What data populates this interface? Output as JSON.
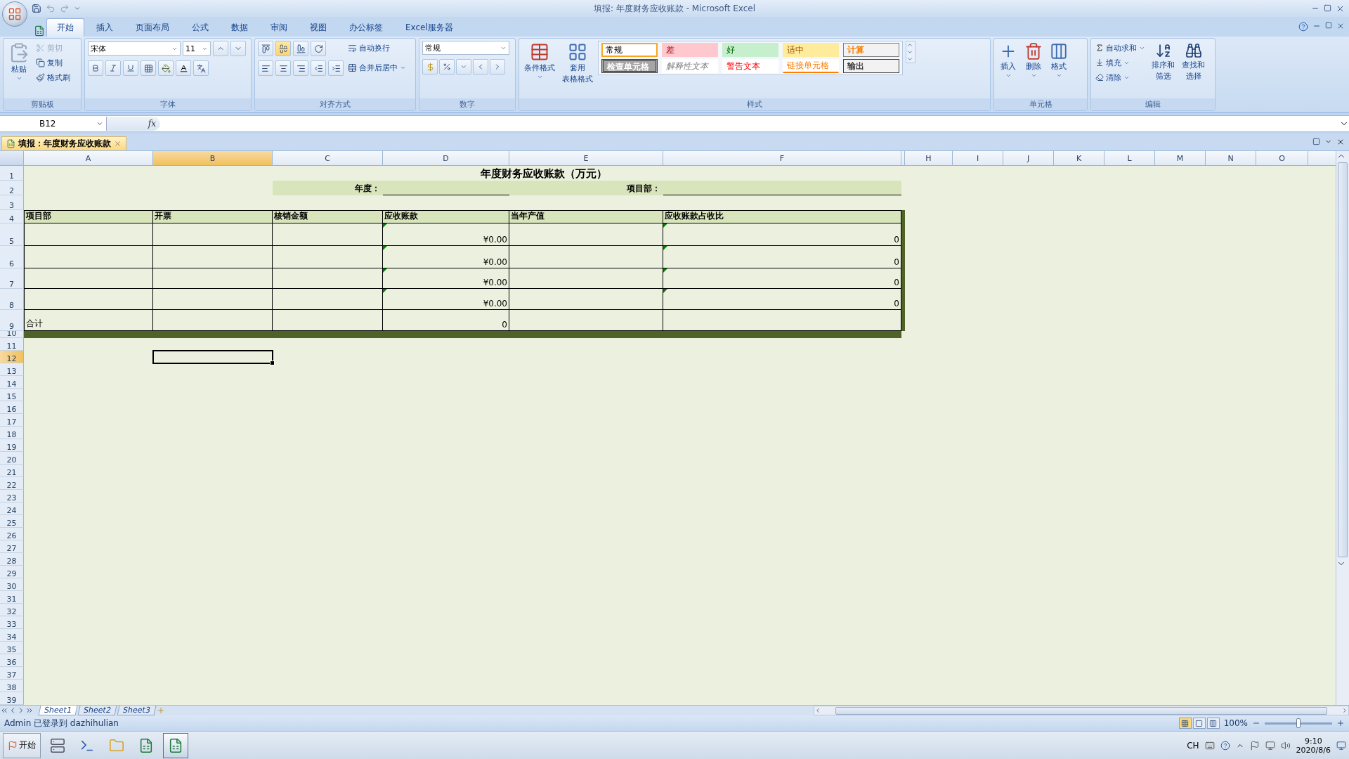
{
  "title_bar": {
    "title": "填报: 年度财务应收账款 - Microsoft Excel"
  },
  "ribbon_tabs": [
    {
      "label": "开始",
      "selected": true
    },
    {
      "label": "插入",
      "selected": false
    },
    {
      "label": "页面布局",
      "selected": false
    },
    {
      "label": "公式",
      "selected": false
    },
    {
      "label": "数据",
      "selected": false
    },
    {
      "label": "审阅",
      "selected": false
    },
    {
      "label": "视图",
      "selected": false
    },
    {
      "label": "办公标签",
      "selected": false
    },
    {
      "label": "Excel服务器",
      "selected": false
    }
  ],
  "ribbon": {
    "clipboard": {
      "title": "剪贴板",
      "paste": "粘贴",
      "cut": {
        "label": "剪切",
        "disabled": true
      },
      "copy": {
        "label": "复制",
        "disabled": false
      },
      "format_painter": {
        "label": "格式刷",
        "disabled": false
      }
    },
    "font": {
      "title": "字体",
      "font_name": "宋体",
      "font_size": "11"
    },
    "alignment": {
      "title": "对齐方式",
      "vertical": [
        {
          "selected": false
        },
        {
          "selected": true
        },
        {
          "selected": false
        }
      ],
      "wrap_text": "自动换行",
      "merge_center": "合并后居中"
    },
    "number": {
      "title": "数字",
      "format": "常规"
    },
    "styles": {
      "title": "样式",
      "conditional": [
        "条件格式"
      ],
      "table_format": [
        "套用",
        "表格格式"
      ],
      "cell_styles": [
        {
          "label": "常规",
          "kind": "normal",
          "selected": true
        },
        {
          "label": "差",
          "kind": "bad",
          "selected": false
        },
        {
          "label": "好",
          "kind": "good",
          "selected": false
        },
        {
          "label": "适中",
          "kind": "neutral",
          "selected": false
        },
        {
          "label": "计算",
          "kind": "calculation",
          "selected": false
        },
        {
          "label": "检查单元格",
          "kind": "check",
          "selected": false
        },
        {
          "label": "解释性文本",
          "kind": "explanatory",
          "selected": false
        },
        {
          "label": "警告文本",
          "kind": "warning",
          "selected": false
        },
        {
          "label": "链接单元格",
          "kind": "linked",
          "selected": false
        },
        {
          "label": "输出",
          "kind": "output",
          "selected": false
        }
      ]
    },
    "cells": {
      "title": "单元格",
      "insert": "插入",
      "delete": "删除",
      "format": "格式"
    },
    "editing": {
      "title": "编辑",
      "autosum": "自动求和",
      "fill": "填充",
      "clear": "清除",
      "sort": [
        "排序和",
        "筛选"
      ],
      "find": [
        "查找和",
        "选择"
      ]
    }
  },
  "formula_bar": {
    "name_box": "B12",
    "function_label": "fx"
  },
  "workbook_tab": {
    "title": "填报：年度财务应收账款"
  },
  "sheet": {
    "column_headers": [
      {
        "label": "A",
        "selected": false
      },
      {
        "label": "B",
        "selected": true
      },
      {
        "label": "C",
        "selected": false
      },
      {
        "label": "D",
        "selected": false
      },
      {
        "label": "E",
        "selected": false
      },
      {
        "label": "F",
        "selected": false
      },
      {
        "label": "H",
        "selected": false
      },
      {
        "label": "I",
        "selected": false
      },
      {
        "label": "J",
        "selected": false
      },
      {
        "label": "K",
        "selected": false
      },
      {
        "label": "L",
        "selected": false
      },
      {
        "label": "M",
        "selected": false
      },
      {
        "label": "N",
        "selected": false
      },
      {
        "label": "O",
        "selected": false
      }
    ],
    "row_headers": [
      {
        "label": "1",
        "selected": false
      },
      {
        "label": "2",
        "selected": false
      },
      {
        "label": "3",
        "selected": false
      },
      {
        "label": "4",
        "selected": false
      },
      {
        "label": "5",
        "selected": false
      },
      {
        "label": "6",
        "selected": false
      },
      {
        "label": "7",
        "selected": false
      },
      {
        "label": "8",
        "selected": false
      },
      {
        "label": "9",
        "selected": false
      },
      {
        "label": "10",
        "selected": false
      },
      {
        "label": "11",
        "selected": false
      },
      {
        "label": "12",
        "selected": true
      },
      {
        "label": "13",
        "selected": false
      },
      {
        "label": "14",
        "selected": false
      },
      {
        "label": "15",
        "selected": false
      },
      {
        "label": "16",
        "selected": false
      },
      {
        "label": "17",
        "selected": false
      },
      {
        "label": "18",
        "selected": false
      },
      {
        "label": "19",
        "selected": false
      },
      {
        "label": "20",
        "selected": false
      },
      {
        "label": "21",
        "selected": false
      },
      {
        "label": "22",
        "selected": false
      },
      {
        "label": "23",
        "selected": false
      },
      {
        "label": "24",
        "selected": false
      },
      {
        "label": "25",
        "selected": false
      },
      {
        "label": "26",
        "selected": false
      },
      {
        "label": "27",
        "selected": false
      },
      {
        "label": "28",
        "selected": false
      },
      {
        "label": "29",
        "selected": false
      },
      {
        "label": "30",
        "selected": false
      },
      {
        "label": "31",
        "selected": false
      },
      {
        "label": "32",
        "selected": false
      },
      {
        "label": "33",
        "selected": false
      },
      {
        "label": "34",
        "selected": false
      },
      {
        "label": "35",
        "selected": false
      },
      {
        "label": "36",
        "selected": false
      },
      {
        "label": "37",
        "selected": false
      },
      {
        "label": "38",
        "selected": false
      },
      {
        "label": "39",
        "selected": false
      }
    ],
    "report": {
      "title": "年度财务应收账款（万元）",
      "year_label": "年度：",
      "dept_label": "项目部：",
      "columns": [
        "项目部",
        "开票",
        "核销金额",
        "应收账款",
        "当年产值",
        "应收账款占收比"
      ],
      "rows": [
        {
          "receivable": "¥0.00",
          "receivable_flagged": true,
          "ratio": "0",
          "ratio_flagged": true
        },
        {
          "receivable": "¥0.00",
          "receivable_flagged": true,
          "ratio": "0",
          "ratio_flagged": true
        },
        {
          "receivable": "¥0.00",
          "receivable_flagged": true,
          "ratio": "0",
          "ratio_flagged": true
        },
        {
          "receivable": "¥0.00",
          "receivable_flagged": true,
          "ratio": "0",
          "ratio_flagged": true
        }
      ],
      "total": {
        "label": "合计",
        "receivable": "0"
      }
    }
  },
  "sheet_tabs": [
    {
      "label": "Sheet1",
      "selected": true
    },
    {
      "label": "Sheet2",
      "selected": false
    },
    {
      "label": "Sheet3",
      "selected": false
    }
  ],
  "status_bar": {
    "text": "Admin 已登录到 dazhihulian",
    "view_modes": [
      {
        "selected": true
      },
      {
        "selected": false
      },
      {
        "selected": false
      }
    ],
    "zoom": "100%",
    "zoom_level": {
      "level": 0.5
    }
  },
  "taskbar": {
    "start": "开始",
    "apps": [
      {
        "selected": false
      },
      {
        "selected": false
      },
      {
        "selected": false
      },
      {
        "selected": false
      },
      {
        "selected": true
      }
    ],
    "language": "CH",
    "time": "9:10",
    "date": "2020/8/6"
  }
}
